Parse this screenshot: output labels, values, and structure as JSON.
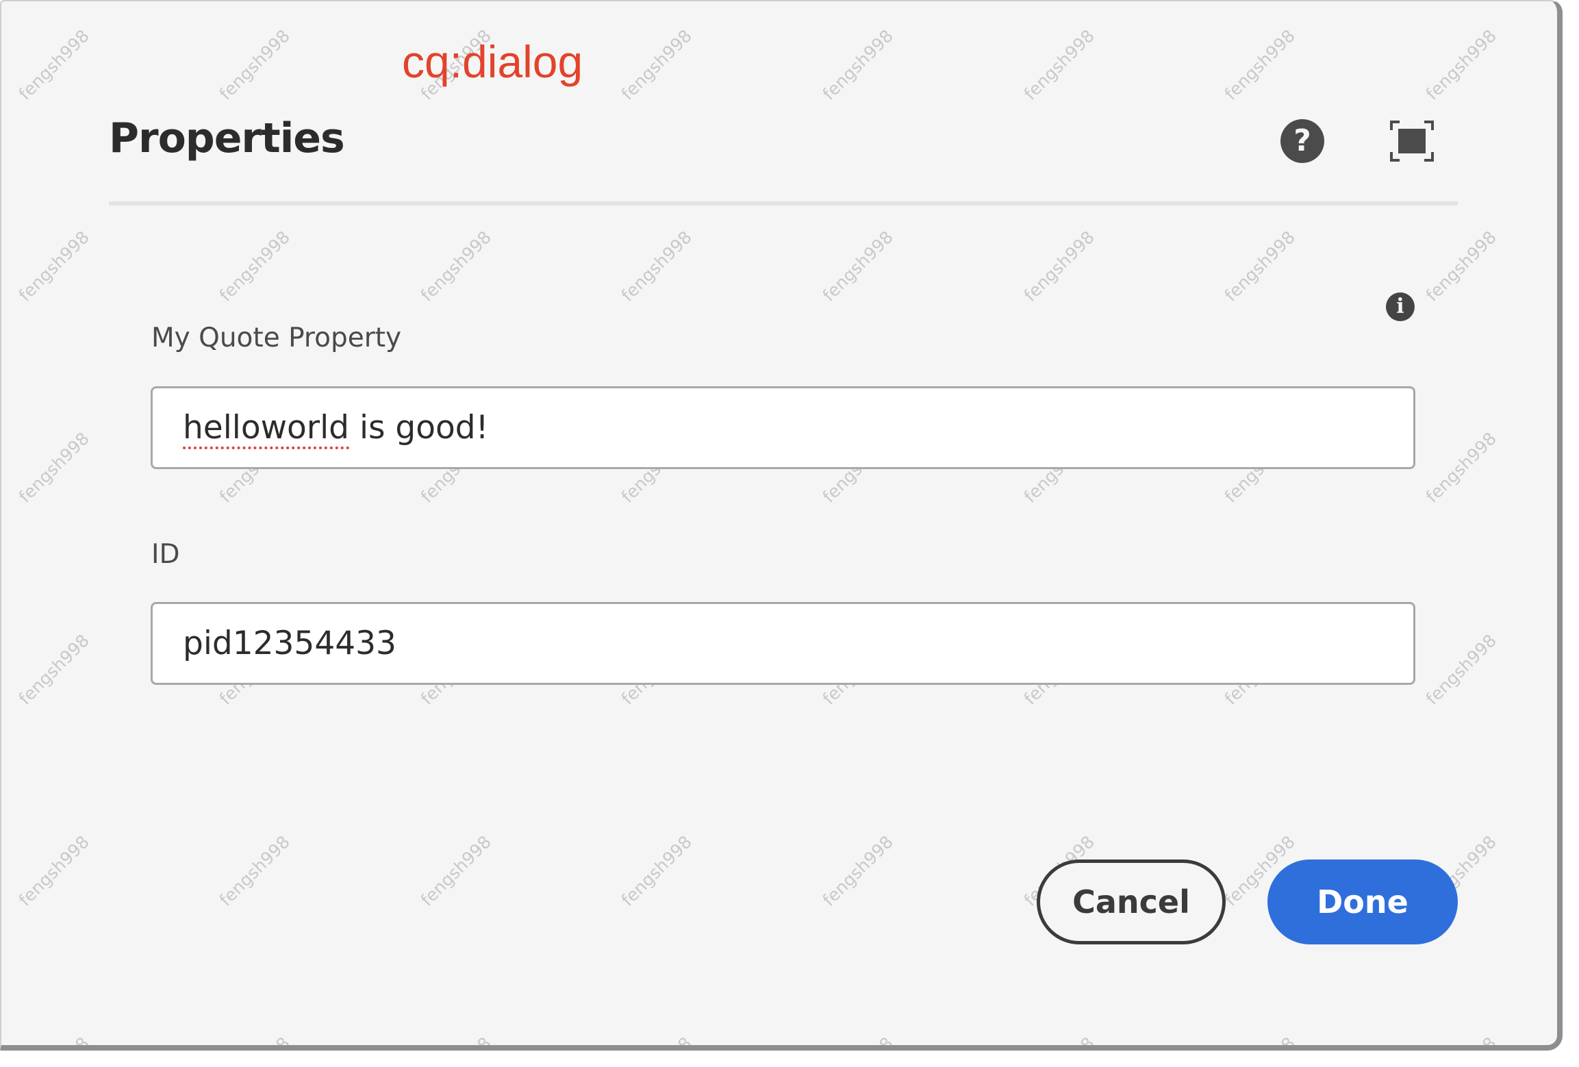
{
  "annotation": {
    "text": "cq:dialog",
    "color": "#e2432a"
  },
  "dialog": {
    "title": "Properties",
    "help_icon": "help-circle-icon",
    "help_glyph": "?",
    "fullscreen_icon": "fullscreen-icon"
  },
  "fields": [
    {
      "label": "My Quote Property",
      "value_misspelled": "helloworld",
      "value_rest": " is good!",
      "info_icon": "info-circle-icon",
      "info_glyph": "i"
    },
    {
      "label": "ID",
      "value": "pid12354433"
    }
  ],
  "footer": {
    "cancel_label": "Cancel",
    "done_label": "Done",
    "primary_color": "#2f6fdc"
  },
  "watermark": {
    "text": "fengsh998"
  }
}
